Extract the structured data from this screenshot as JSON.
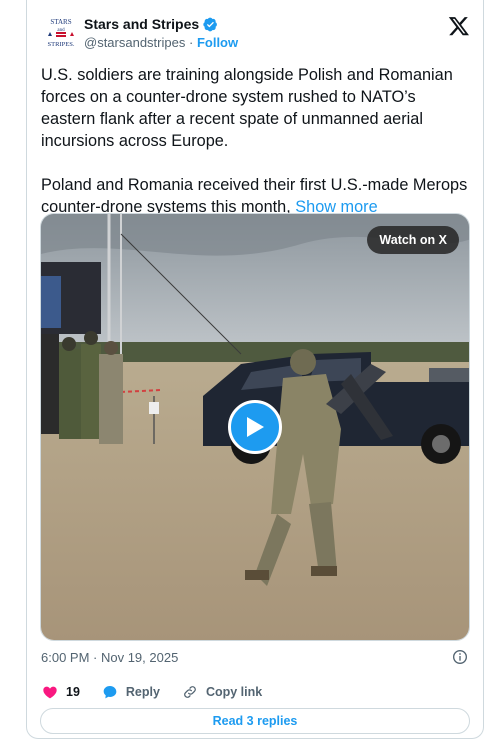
{
  "account": {
    "name": "Stars and Stripes",
    "handle": "@starsandstripes",
    "separator": "·",
    "follow_label": "Follow",
    "logo_text_top": "STARS",
    "logo_text_mid": "and",
    "logo_text_bottom": "STRIPES."
  },
  "post": {
    "paragraph1": "U.S. soldiers are training alongside Polish and Romanian forces on a counter-drone system rushed to NATO’s eastern flank after a recent spate of unmanned aerial incursions across Europe.",
    "paragraph2": "Poland and Romania received their first U.S.-made Merops counter-drone systems this month,",
    "show_more": "Show more"
  },
  "media": {
    "watch_label": "Watch on X"
  },
  "timestamp": "6:00 PM · Nov 19, 2025",
  "actions": {
    "likes": "19",
    "reply_label": "Reply",
    "copy_label": "Copy link"
  },
  "read_replies_label": "Read 3 replies",
  "colors": {
    "accent": "#1d9bf0",
    "like": "#f91880",
    "muted": "#536471"
  },
  "icons": [
    "verified-badge-icon",
    "x-logo-icon",
    "play-icon",
    "info-icon",
    "heart-icon",
    "reply-bubble-icon",
    "link-icon"
  ]
}
